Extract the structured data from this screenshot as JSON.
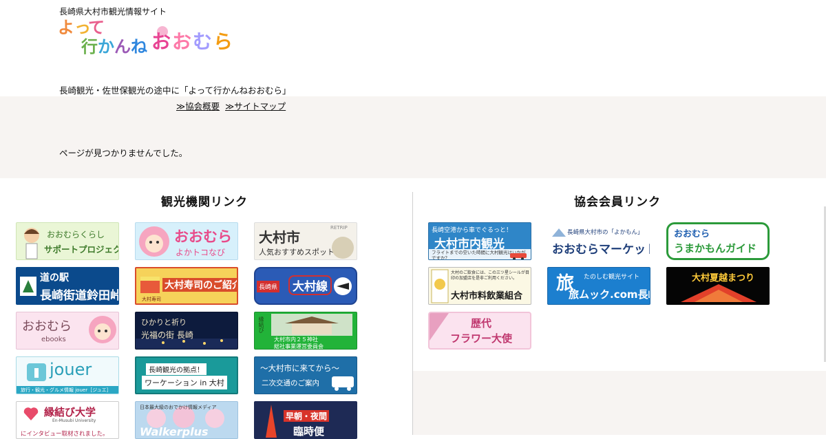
{
  "header": {
    "site_tagline": "長崎県大村市観光情報サイト",
    "logo_text": "よって行かんねおおむら",
    "subtitle": "長崎観光・佐世保観光の途中に「よって行かんねおおむら」"
  },
  "nav": {
    "items": [
      "≫協会概要",
      "≫サイトマップ"
    ]
  },
  "main": {
    "message": "ページが見つかりませんでした。"
  },
  "tourism_links": {
    "title": "観光機関リンク",
    "banners": [
      {
        "l1": "おおむらくらし",
        "l2": "サポートプロジェクト"
      },
      {
        "l1": "おおむら",
        "l2": "よかトコなび"
      },
      {
        "l1": "大村市",
        "l2": "人気おすすめスポット",
        "tag": "RETRIP"
      },
      {
        "l1": "道の駅",
        "l2": "長崎街道鈴田峠"
      },
      {
        "l1": "大村寿司のご紹介",
        "l2": "大村寿司"
      },
      {
        "l1": "長崎県",
        "l2": "大村線"
      },
      {
        "l1": "おおむら",
        "l2": "ebooks"
      },
      {
        "l1": "ひかりと祈り",
        "l2": "光福の街 長崎"
      },
      {
        "l1": "大村市内２５神社",
        "l2": "総社事業運営委員会",
        "l3": "縁結び"
      },
      {
        "l1": "jouer",
        "l2": "旅行・観光・グルメ情報 jouer［ジュエ］"
      },
      {
        "l1": "長崎観光の拠点！",
        "l2": "ワーケーション in 大村"
      },
      {
        "l1": "～大村市に来てから～",
        "l2": "二次交通のご案内"
      },
      {
        "l1": "縁結び大学",
        "l2": "En-Musubi University",
        "l3": "にインタビュー取材されました。"
      },
      {
        "l1": "Walkerplus",
        "l2": "日本最大級のおでかけ情報メディア"
      },
      {
        "l1": "早朝・夜間",
        "l2": "臨時便"
      }
    ]
  },
  "member_links": {
    "title": "協会会員リンク",
    "banners": [
      {
        "l1": "長崎空港から車でぐるっと！",
        "l2": "大村市内観光",
        "l3": "フライトまでの空いた時間に大村観光はいかがですか？"
      },
      {
        "l1": "長崎県大村市の「よかもん」",
        "l2": "おおむらマーケット"
      },
      {
        "l1": "おおむら",
        "l2": "うまかもんガイド"
      },
      {
        "l1": "大村のご飲食には、この三ツ星シールが目印の加盟店を是非ご利用ください。",
        "l2": "大村市料飲業組合"
      },
      {
        "l1": "たのしむ観光サイト",
        "l2": "旅ムック.com長崎",
        "l3": "旅"
      },
      {
        "l1": "大村夏越まつり",
        "l2": ""
      },
      {
        "l1": "歴代",
        "l2": "フラワー大使"
      }
    ]
  },
  "colors": {
    "band_bg": "#f7f4f2",
    "divider": "#cfcfcf"
  }
}
